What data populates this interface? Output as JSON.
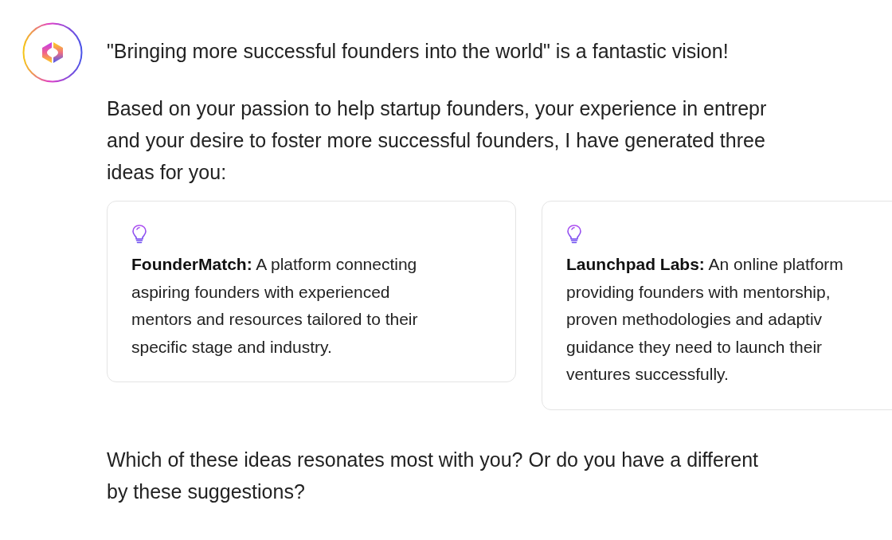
{
  "message": {
    "paragraphs": [
      {
        "lines": [
          "\"Bringing more successful founders into the world\" is a fantastic vision!"
        ]
      },
      {
        "lines": [
          "Based on your passion to help startup founders, your experience in entrepr",
          "and your desire to foster more successful founders, I have generated three",
          "ideas for you:"
        ]
      }
    ],
    "ideas": [
      {
        "lines": [
          "**FounderMatch:** A platform connecting",
          "aspiring founders with experienced",
          "mentors and resources tailored to their",
          "specific stage and industry."
        ]
      },
      {
        "lines": [
          "**Launchpad Labs:** An online platform",
          "providing founders with mentorship,",
          "proven methodologies and adaptiv",
          "guidance they need to launch their",
          "ventures successfully."
        ]
      }
    ],
    "closing": {
      "lines": [
        "Which of these ideas resonates most with you? Or do you have a different",
        "by these suggestions?"
      ]
    }
  }
}
